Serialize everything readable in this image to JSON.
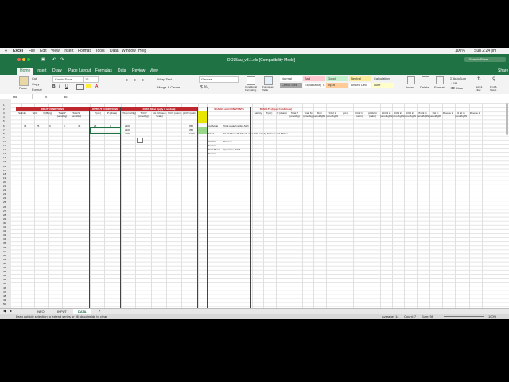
{
  "menubar": {
    "apple": "",
    "items": [
      "Excel",
      "File",
      "Edit",
      "View",
      "Insert",
      "Format",
      "Tools",
      "Data",
      "Window",
      "Help"
    ],
    "right": "Sun 2:24 pm",
    "battery": "100%"
  },
  "window": {
    "title": "DO35au_v3.1.xls  [Compatibility Mode]"
  },
  "quick_search": "Search Sheet",
  "ribbon_tabs": [
    "Home",
    "Insert",
    "Draw",
    "Page Layout",
    "Formulas",
    "Data",
    "Review",
    "View"
  ],
  "share": "Share",
  "ribbon": {
    "paste": "Paste",
    "cut": "Cut",
    "copy": "Copy",
    "format": "Format",
    "font_name": "Comic Sans...",
    "font_size": "12",
    "wrap_text": "Wrap Text",
    "merge": "Merge & Centre",
    "number_format": "General",
    "conditional": "Conditional Formatting",
    "format_table": "Format as Table",
    "styles": [
      {
        "label": "Normal",
        "bg": "#ffffff"
      },
      {
        "label": "Bad",
        "bg": "#ffc7ce"
      },
      {
        "label": "Good",
        "bg": "#c6efce"
      },
      {
        "label": "Neutral",
        "bg": "#ffeb9c"
      },
      {
        "label": "Calculation",
        "bg": "#f2f2f2"
      },
      {
        "label": "Check Cell",
        "bg": "#a5a5a5"
      },
      {
        "label": "Explanatory T...",
        "bg": "#ffffff"
      },
      {
        "label": "Input",
        "bg": "#ffcc99"
      },
      {
        "label": "Linked Cell",
        "bg": "#ffffff"
      },
      {
        "label": "Note",
        "bg": "#ffffcc"
      }
    ],
    "insert": "Insert",
    "delete": "Delete",
    "format_cells": "Format",
    "autosum": "AutoSum",
    "fill": "Fill",
    "clear": "Clear",
    "sort_filter": "Sort & Filter",
    "find_select": "Find & Select"
  },
  "formula": {
    "name_box": "H5",
    "fx": "fx",
    "value": "36"
  },
  "columns": [
    "A",
    "B",
    "C",
    "D",
    "E",
    "F",
    "G",
    "H",
    "I",
    "J",
    "K",
    "L",
    "M",
    "N",
    "O",
    "P",
    "Q",
    "R",
    "S",
    "T",
    "U",
    "V",
    "W",
    "X",
    "Y",
    "Z",
    "AA",
    "AB",
    "AC",
    "AD",
    "AE",
    "AF",
    "AG",
    "AH",
    "AI"
  ],
  "section_headers": [
    {
      "label": "INPUT CONDITIONS"
    },
    {
      "label": "OUTPUT CONDITIONS"
    },
    {
      "label": "DATA (Must Apply if no data)"
    },
    {
      "label": "SCALES and CONSTANTS"
    },
    {
      "label": "RESULTS (Input Conditions)"
    }
  ],
  "input_cols": [
    "Salinity",
    "SiO2",
    "P (Barg)",
    "Total P (umol/kg)",
    "Total Si (umol/kg)"
  ],
  "output_cols": [
    "T(oC)",
    "P (dbars)"
  ],
  "data_cols": [
    "TA (umol/kg)",
    "TCO2 (umol/kg)",
    "pH (Chosen Scale)",
    "fCO2 (uatm)",
    "pCO2 (uatm)"
  ],
  "scale_rows": [
    {
      "k": "pH Scale",
      "v": "Total scale (mol/kg-SW)"
    },
    {
      "k": "K1K2",
      "v": "K1, K2 from Mehrbach et al 1973 refit by Dickson and Millero"
    },
    {
      "k": "KHSO4",
      "v": "Dickson"
    },
    {
      "k": "Source",
      "v": ""
    },
    {
      "k": "Total Boron",
      "v": "Uppstrom, 1974"
    },
    {
      "k": "Source",
      "v": ""
    }
  ],
  "result_cols": [
    "Salinity",
    "T(oC)",
    "P (dbars)",
    "Total P (umol/kg)",
    "Total Si (umol/kg)",
    "TA in (umol/kgSW)",
    "TCO2 in (umol/kgSW)",
    "pH in",
    "fCO2 in (uatm)",
    "pCO2 in (uatm)",
    "HCO3 in (umol/kgSW)",
    "CO3 in (umol/kgSW)",
    "CO2 in (umol/kgSW)",
    "B Alk in (umol/kgSW)",
    "OH in (umol/kgSW)",
    "Revelle in",
    "% ab in (umol/kgSW)",
    "Revelle in"
  ],
  "row1": [
    "36",
    "25",
    "0",
    "0",
    "45",
    "25",
    "0"
  ],
  "data_vals": [
    "2300",
    "2300",
    "2000",
    "950",
    "350",
    "1000"
  ],
  "rows": [
    "1",
    "2",
    "3",
    "4",
    "5",
    "6",
    "7",
    "8",
    "9",
    "10",
    "11",
    "12",
    "13",
    "14",
    "15",
    "16",
    "17",
    "18",
    "19",
    "20",
    "21",
    "22",
    "23",
    "24",
    "25",
    "26",
    "27",
    "28",
    "29",
    "30",
    "31",
    "32",
    "33",
    "34",
    "35",
    "36",
    "37",
    "38",
    "39",
    "40",
    "41",
    "42",
    "43",
    "44",
    "45",
    "46",
    "47",
    "48",
    "49",
    "50"
  ],
  "sheet_tabs": [
    "INFO",
    "INPUT",
    "DATA"
  ],
  "active_tab": "DATA",
  "status": {
    "message": "Drag outside selection to extend series or fill; drag inside to clear",
    "average": "Average: 14",
    "count": "Count: 7",
    "sum": "Sum: 98",
    "zoom": "100%"
  },
  "colors": {
    "excel_green": "#1f7244",
    "header_red": "#c0282f"
  }
}
